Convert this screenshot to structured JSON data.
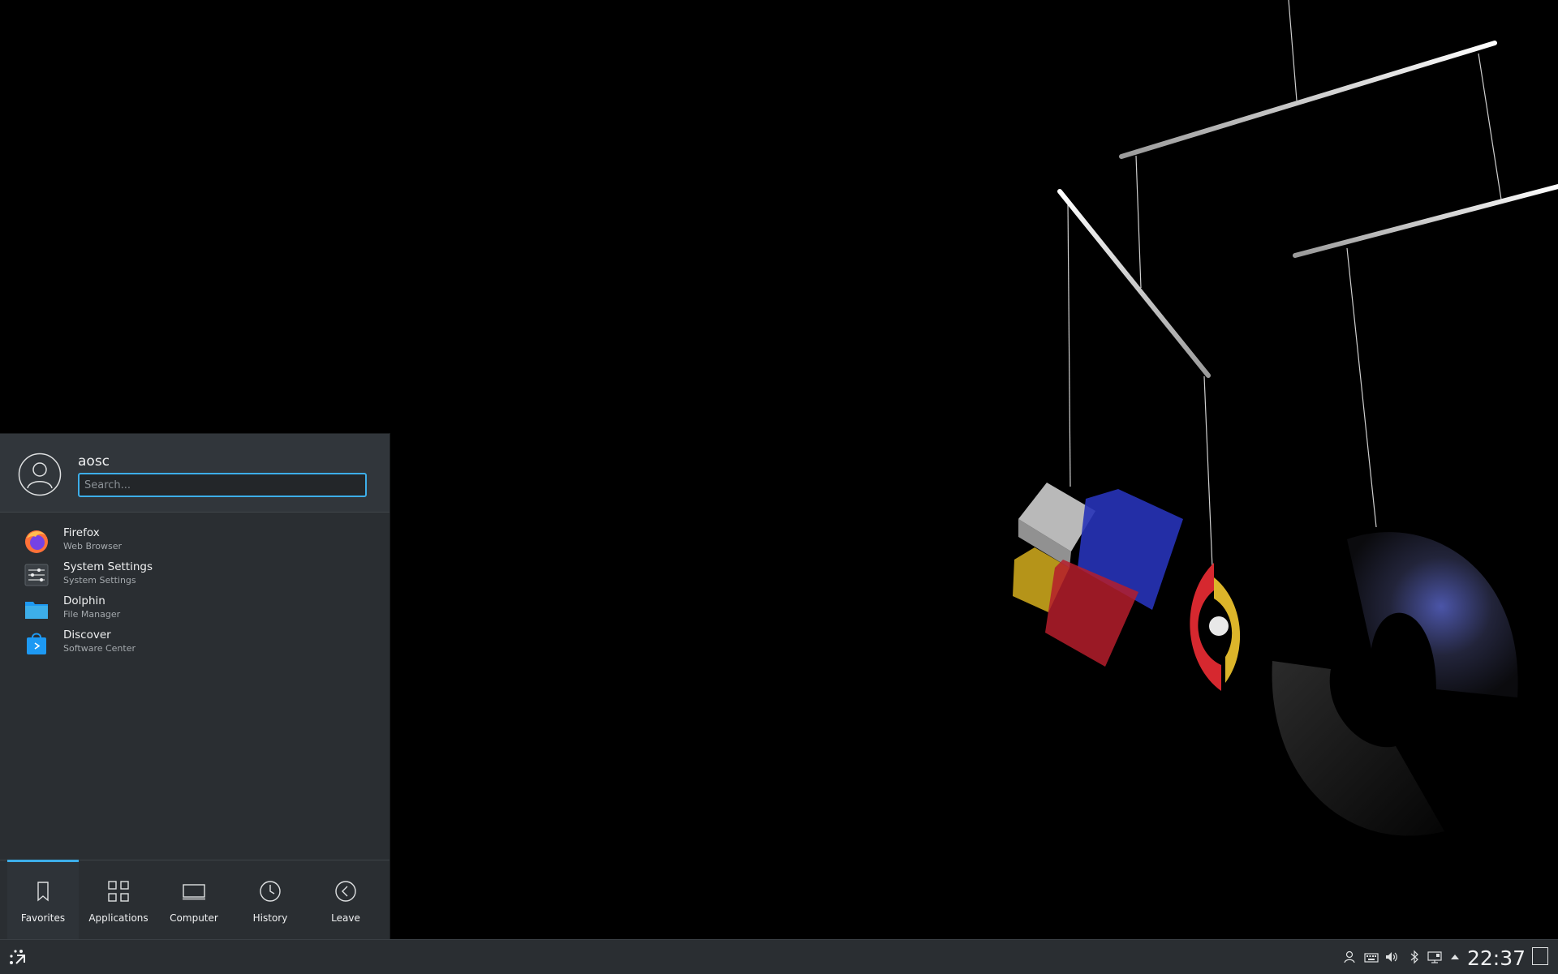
{
  "user": {
    "name": "aosc"
  },
  "search": {
    "placeholder": "Search..."
  },
  "favorites": [
    {
      "name": "Firefox",
      "description": "Web Browser",
      "icon": "firefox-icon"
    },
    {
      "name": "System Settings",
      "description": "System Settings",
      "icon": "settings-icon"
    },
    {
      "name": "Dolphin",
      "description": "File Manager",
      "icon": "folder-icon"
    },
    {
      "name": "Discover",
      "description": "Software Center",
      "icon": "store-bag-icon"
    }
  ],
  "tabs": [
    {
      "label": "Favorites",
      "icon": "bookmark-icon",
      "active": true
    },
    {
      "label": "Applications",
      "icon": "grid-icon",
      "active": false
    },
    {
      "label": "Computer",
      "icon": "laptop-icon",
      "active": false
    },
    {
      "label": "History",
      "icon": "clock-icon",
      "active": false
    },
    {
      "label": "Leave",
      "icon": "back-circle-icon",
      "active": false
    }
  ],
  "taskbar": {
    "clock": "22:37",
    "tray_icons": [
      "user-switch-icon",
      "keyboard-icon",
      "volume-icon",
      "bluetooth-icon",
      "network-icon",
      "expand-tray-icon"
    ]
  },
  "colors": {
    "accent": "#3daee9",
    "panel": "#2a2e32",
    "desktop": "#000000"
  }
}
